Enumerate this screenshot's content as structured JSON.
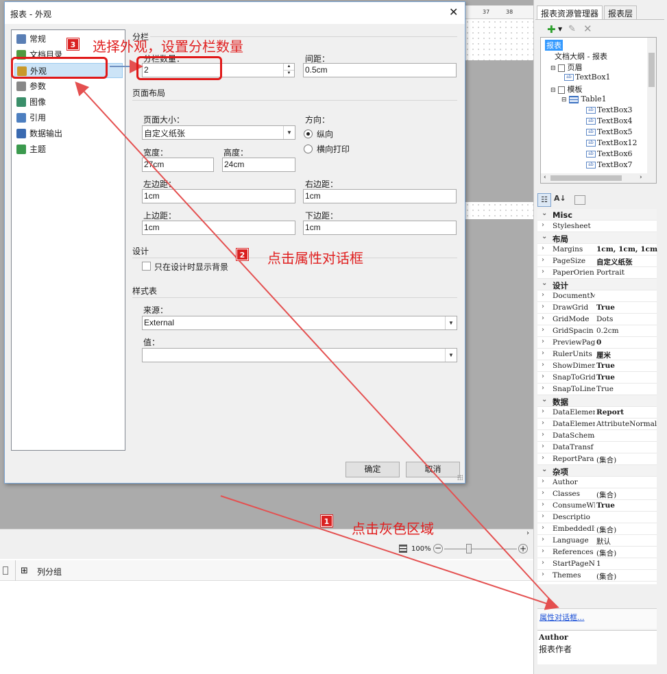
{
  "background": {
    "ruler_numbers": [
      "37",
      "38"
    ],
    "zoom_level": "100%",
    "group_pane_title": "列分组"
  },
  "right_panel": {
    "tabs": [
      {
        "label": "报表资源管理器",
        "active": true
      },
      {
        "label": "报表层",
        "active": false
      }
    ],
    "tree": [
      {
        "label": "报表",
        "selected": true
      },
      {
        "label": "文档大纲 - 报表"
      },
      {
        "label": "页眉"
      },
      {
        "label": "TextBox1"
      },
      {
        "label": "模板"
      },
      {
        "label": "Table1"
      },
      {
        "label": "TextBox3"
      },
      {
        "label": "TextBox4"
      },
      {
        "label": "TextBox5"
      },
      {
        "label": "TextBox12"
      },
      {
        "label": "TextBox6"
      },
      {
        "label": "TextBox7"
      }
    ],
    "properties": [
      {
        "name": "Misc",
        "category": true
      },
      {
        "name": "Stylesheet",
        "value": ""
      },
      {
        "name": "布局",
        "category": true
      },
      {
        "name": "Margins",
        "value": "1cm, 1cm, 1cm",
        "bold": true
      },
      {
        "name": "PageSize",
        "value": "自定义纸张",
        "bold": true
      },
      {
        "name": "PaperOrien",
        "value": "Portrait"
      },
      {
        "name": "设计",
        "category": true
      },
      {
        "name": "DocumentMa",
        "value": ""
      },
      {
        "name": "DrawGrid",
        "value": "True",
        "bold": true
      },
      {
        "name": "GridMode",
        "value": "Dots"
      },
      {
        "name": "GridSpacin",
        "value": "0.2cm"
      },
      {
        "name": "PreviewPag",
        "value": "0",
        "bold": true
      },
      {
        "name": "RulerUnits",
        "value": "厘米",
        "bold": true
      },
      {
        "name": "ShowDimens",
        "value": "True",
        "bold": true
      },
      {
        "name": "SnapToGrid",
        "value": "True",
        "bold": true
      },
      {
        "name": "SnapToLine",
        "value": "True"
      },
      {
        "name": "数据",
        "category": true
      },
      {
        "name": "DataElemen",
        "value": "Report",
        "bold": true
      },
      {
        "name": "DataElemen",
        "value": "AttributeNormal"
      },
      {
        "name": "DataSchema",
        "value": ""
      },
      {
        "name": "DataTransf",
        "value": ""
      },
      {
        "name": "ReportPara",
        "value": "(集合)"
      },
      {
        "name": "杂项",
        "category": true
      },
      {
        "name": "Author",
        "value": ""
      },
      {
        "name": "Classes",
        "value": "(集合)"
      },
      {
        "name": "ConsumeWhi",
        "value": "True",
        "bold": true
      },
      {
        "name": "Descriptio",
        "value": ""
      },
      {
        "name": "EmbeddedIm",
        "value": "(集合)"
      },
      {
        "name": "Language",
        "value": "默认"
      },
      {
        "name": "References",
        "value": "(集合)"
      },
      {
        "name": "StartPageN",
        "value": "1"
      },
      {
        "name": "Themes",
        "value": "(集合)"
      }
    ],
    "property_dialog_link": "属性对话框...",
    "desc_title": "Author",
    "desc_text": "报表作者"
  },
  "dialog": {
    "title": "报表 - 外观",
    "nav": [
      {
        "label": "常规",
        "icon": "general-icon"
      },
      {
        "label": "文档目录",
        "icon": "toc-icon"
      },
      {
        "label": "外观",
        "icon": "appearance-icon",
        "selected": true
      },
      {
        "label": "参数",
        "icon": "parameters-icon"
      },
      {
        "label": "图像",
        "icon": "image-icon"
      },
      {
        "label": "引用",
        "icon": "references-icon"
      },
      {
        "label": "数据输出",
        "icon": "data-output-icon"
      },
      {
        "label": "主题",
        "icon": "theme-icon"
      }
    ],
    "columns_section": "分栏",
    "columns_count_label": "分栏数量：",
    "columns_count_value": "2",
    "spacing_label": "间距：",
    "spacing_value": "0.5cm",
    "page_layout_section": "页面布局",
    "page_size_label": "页面大小：",
    "page_size_value": "自定义纸张",
    "orientation_label": "方向：",
    "orientation_portrait": "纵向",
    "orientation_landscape": "横向打印",
    "width_label": "宽度：",
    "width_value": "27cm",
    "height_label": "高度：",
    "height_value": "24cm",
    "left_margin_label": "左边距：",
    "left_margin_value": "1cm",
    "right_margin_label": "右边距：",
    "right_margin_value": "1cm",
    "top_margin_label": "上边距：",
    "top_margin_value": "1cm",
    "bottom_margin_label": "下边距：",
    "bottom_margin_value": "1cm",
    "design_section": "设计",
    "design_checkbox_label": "只在设计时显示背景",
    "stylesheet_section": "样式表",
    "source_label": "来源：",
    "source_value": "External",
    "value_label": "值：",
    "value_value": "",
    "ok_label": "确定",
    "cancel_label": "取消"
  },
  "annotations": {
    "step1_badge": "1",
    "step1_text": "点击灰色区域",
    "step2_badge": "2",
    "step2_text": "点击属性对话框",
    "step3_badge": "3",
    "step3_text": "选择外观，设置分栏数量",
    "color": "#e02020"
  }
}
